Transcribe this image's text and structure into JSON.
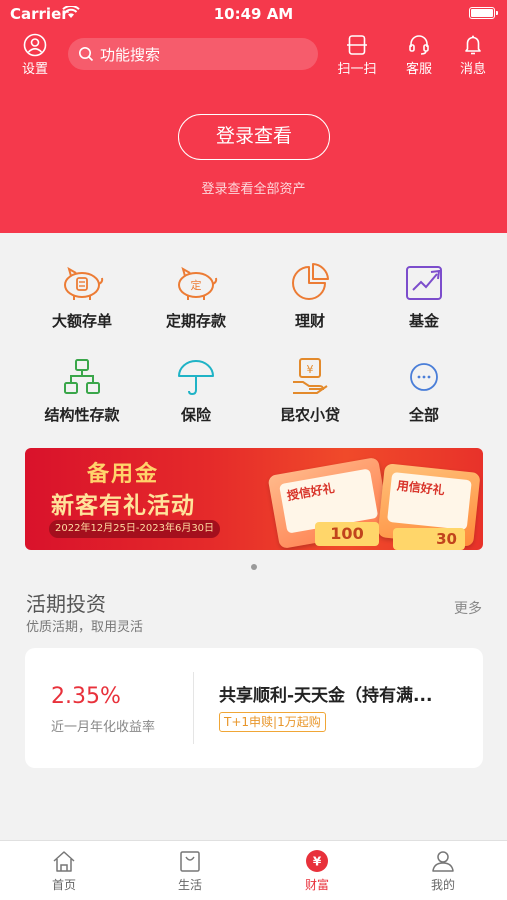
{
  "status_bar": {
    "carrier": "Carrier",
    "time": "10:49 AM"
  },
  "header": {
    "settings_label": "设置",
    "search_placeholder": "功能搜索",
    "scan_label": "扫一扫",
    "service_label": "客服",
    "message_label": "消息",
    "login_button": "登录查看",
    "login_subtitle": "登录查看全部资产",
    "brand_color": "#f5394c"
  },
  "menu": {
    "items": [
      {
        "label": "大额存单",
        "icon": "piggy-bank-icon"
      },
      {
        "label": "定期存款",
        "icon": "fixed-deposit-icon"
      },
      {
        "label": "理财",
        "icon": "pie-chart-icon"
      },
      {
        "label": "基金",
        "icon": "trend-chart-icon"
      },
      {
        "label": "结构性存款",
        "icon": "structure-icon"
      },
      {
        "label": "保险",
        "icon": "umbrella-icon"
      },
      {
        "label": "昆农小贷",
        "icon": "loan-icon"
      },
      {
        "label": "全部",
        "icon": "more-icon"
      }
    ]
  },
  "banner": {
    "title_line1": "备用金",
    "title_line2": "新客有礼活动",
    "date_range": "2022年12月25日-2023年6月30日",
    "card1_text": "授信好礼",
    "card2_text": "用信好礼",
    "ticket1": "100",
    "ticket2": "30"
  },
  "section": {
    "title": "活期投资",
    "subtitle": "优质活期，取用灵活",
    "more": "更多"
  },
  "product": {
    "rate": "2.35%",
    "rate_label": "近一月年化收益率",
    "name": "共享顺利-天天金（持有满...",
    "tag": "T+1申赎|1万起购"
  },
  "tabbar": {
    "tabs": [
      {
        "label": "首页",
        "active": false
      },
      {
        "label": "生活",
        "active": false
      },
      {
        "label": "财富",
        "active": true
      },
      {
        "label": "我的",
        "active": false
      }
    ]
  }
}
